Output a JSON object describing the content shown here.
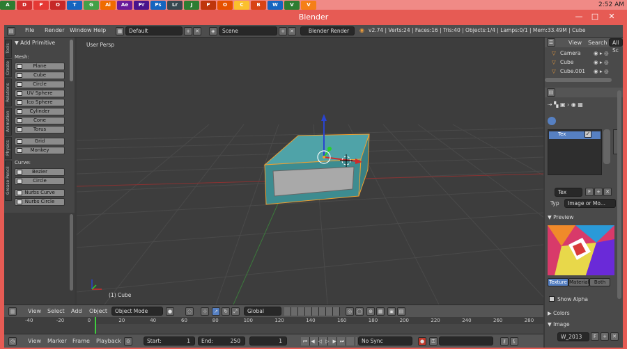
{
  "taskbar": {
    "icons": [
      "A",
      "D",
      "P",
      "O",
      "T",
      "G",
      "Ai",
      "Ae",
      "Pr",
      "Ps",
      "Lr",
      "J",
      "P",
      "O",
      "C",
      "B",
      "W",
      "V",
      "V"
    ],
    "icon_colors": [
      "#2e7d32",
      "#d32f2f",
      "#e53935",
      "#c62828",
      "#1565c0",
      "#43a047",
      "#ef6c00",
      "#6a1b9a",
      "#4a148c",
      "#1565c0",
      "#37474f",
      "#2e7d32",
      "#bf360c",
      "#e65100",
      "#fbc02d",
      "#d84315",
      "#1565c0",
      "#2e7d32",
      "#f57f17"
    ],
    "time": "2:52 AM"
  },
  "window": {
    "title": "Blender",
    "minimize": "—",
    "maximize": "□",
    "close": "✕"
  },
  "topbar": {
    "menu": [
      "File",
      "Render",
      "Window",
      "Help"
    ],
    "layout": "Default",
    "scene": "Scene",
    "engine": "Blender Render",
    "stats": "v2.74 | Verts:24 | Faces:16 | Tris:40 | Objects:1/4 | Lamps:0/1 | Mem:33.49M | Cube"
  },
  "tools": {
    "header": "▼ Add Primitive",
    "tabs": [
      "Tools",
      "Create",
      "Relations",
      "Animation",
      "Physics",
      "Grease Pencil"
    ],
    "mesh_label": "Mesh:",
    "mesh": [
      "Plane",
      "Cube",
      "Circle",
      "UV Sphere",
      "Ico Sphere",
      "Cylinder",
      "Cone",
      "Torus",
      "Grid",
      "Monkey"
    ],
    "curve_label": "Curve:",
    "curve": [
      "Bezier",
      "Circle",
      "Nurbs Curve",
      "Nurbs Circle"
    ]
  },
  "viewport": {
    "label": "User Persp",
    "object": "(1) Cube"
  },
  "outliner": {
    "view": "View",
    "search": "Search",
    "all": "All Sc",
    "items": [
      "Camera",
      "Cube",
      "Cube.001"
    ]
  },
  "properties": {
    "slot_name": "Tex",
    "tex_name": "Tex",
    "f_label": "F",
    "type_label": "Typ",
    "type_value": "Image or Mo...",
    "preview_label": "▼ Preview",
    "preview_tabs": [
      "Texture",
      "Material",
      "Both"
    ],
    "show_alpha": "Show Alpha",
    "colors": "▶ Colors",
    "image": "▼ Image",
    "image_name": "W_2013"
  },
  "view_header": {
    "menus": [
      "View",
      "Select",
      "Add",
      "Object"
    ],
    "mode": "Object Mode",
    "orientation": "Global"
  },
  "timeline": {
    "ticks": [
      "-40",
      "-20",
      "0",
      "20",
      "40",
      "60",
      "80",
      "100",
      "120",
      "140",
      "160",
      "180",
      "200",
      "220",
      "240",
      "260",
      "280"
    ],
    "menus": [
      "View",
      "Marker",
      "Frame",
      "Playback"
    ],
    "start_label": "Start:",
    "start": "1",
    "end_label": "End:",
    "end": "250",
    "current": "1",
    "sync": "No Sync"
  },
  "colors": {
    "accent": "#5680c2",
    "cube": "#4fa3a8",
    "title_bg": "#e65b54"
  }
}
